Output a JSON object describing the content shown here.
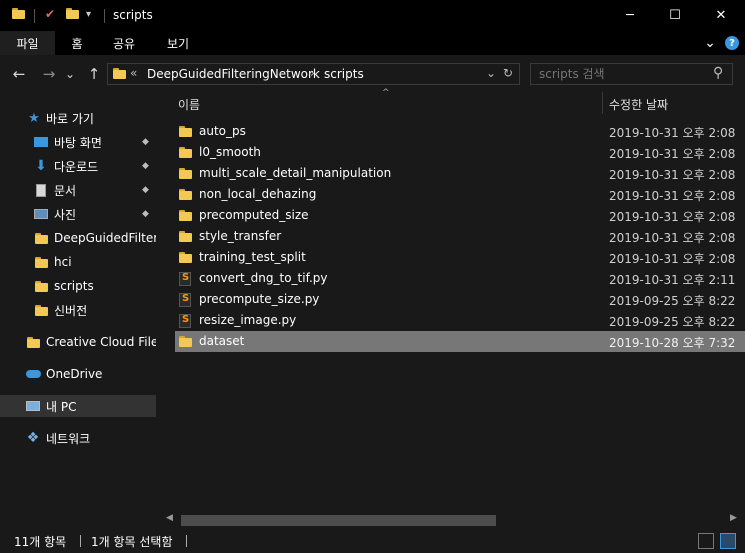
{
  "window": {
    "title": "scripts",
    "minimize_glyph": "─",
    "maximize_glyph": "☐",
    "close_glyph": "✕"
  },
  "ribbon": {
    "tabs": [
      "파일",
      "홈",
      "공유",
      "보기"
    ],
    "expand_glyph": "⌄",
    "help_glyph": "?"
  },
  "address": {
    "back_glyph": "←",
    "forward_glyph": "→",
    "recent_glyph": "⌄",
    "up_glyph": "↑",
    "overflow_glyph": "«",
    "crumbs": [
      "DeepGuidedFilteringNetwork",
      "scripts"
    ],
    "crumb_sep": "›",
    "dropdown_glyph": "⌄",
    "refresh_glyph": "↻"
  },
  "search": {
    "placeholder": "scripts 검색",
    "icon_glyph": "⚲"
  },
  "nav": {
    "quick_access": "바로 가기",
    "pinned": [
      {
        "label": "바탕 화면",
        "icon": "desktop-icon"
      },
      {
        "label": "다운로드",
        "icon": "download-icon"
      },
      {
        "label": "문서",
        "icon": "document-icon"
      },
      {
        "label": "사진",
        "icon": "pictures-icon"
      }
    ],
    "recent": [
      "DeepGuidedFilteringNetwork",
      "hci",
      "scripts",
      "신버전"
    ],
    "creative_cloud": "Creative Cloud Files",
    "onedrive": "OneDrive",
    "this_pc": "내 PC",
    "network": "네트워크",
    "pin_glyph": "📌"
  },
  "columns": {
    "name": "이름",
    "date": "수정한 날짜",
    "sort_glyph": "^"
  },
  "files": [
    {
      "name": "auto_ps",
      "date": "2019-10-31 오후 2:08",
      "type": "folder"
    },
    {
      "name": "l0_smooth",
      "date": "2019-10-31 오후 2:08",
      "type": "folder"
    },
    {
      "name": "multi_scale_detail_manipulation",
      "date": "2019-10-31 오후 2:08",
      "type": "folder"
    },
    {
      "name": "non_local_dehazing",
      "date": "2019-10-31 오후 2:08",
      "type": "folder"
    },
    {
      "name": "precomputed_size",
      "date": "2019-10-31 오후 2:08",
      "type": "folder"
    },
    {
      "name": "style_transfer",
      "date": "2019-10-31 오후 2:08",
      "type": "folder"
    },
    {
      "name": "training_test_split",
      "date": "2019-10-31 오후 2:08",
      "type": "folder"
    },
    {
      "name": "convert_dng_to_tif.py",
      "date": "2019-10-31 오후 2:11",
      "type": "py"
    },
    {
      "name": "precompute_size.py",
      "date": "2019-09-25 오후 8:22",
      "type": "py"
    },
    {
      "name": "resize_image.py",
      "date": "2019-09-25 오후 8:22",
      "type": "py"
    },
    {
      "name": "dataset",
      "date": "2019-10-28 오후 7:32",
      "type": "folder",
      "selected": true
    }
  ],
  "scrollbar": {
    "left_glyph": "◀",
    "right_glyph": "▶"
  },
  "status": {
    "item_count": "11개 항목",
    "selected": "1개 항목 선택함"
  },
  "colors": {
    "background": "#191919",
    "titlebar": "#000000",
    "selected_row": "#777777",
    "folder": "#f4c952",
    "accent_blue": "#3a96dd"
  }
}
